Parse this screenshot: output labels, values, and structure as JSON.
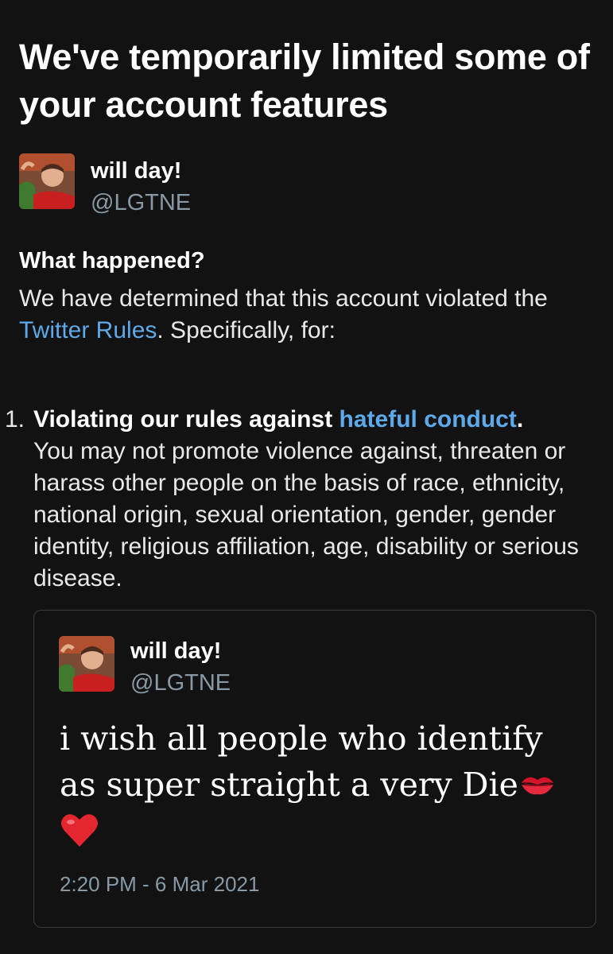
{
  "header": {
    "title": "We've temporarily limited some of your account features"
  },
  "account": {
    "display_name": "will day!",
    "handle": "@LGTNE"
  },
  "what_happened": {
    "heading": "What happened?",
    "body_before": "We have determined that this account violated the ",
    "link": "Twitter Rules",
    "body_after": ". Specifically, for:"
  },
  "rules": [
    {
      "number": "1.",
      "title_before": "Violating our rules against ",
      "title_link": "hateful conduct",
      "title_after": ".",
      "description": "You may not promote violence against, threaten or harass other people on the basis of race, ethnicity, national origin, sexual orientation, gender, gender identity, religious affiliation, age, disability or serious disease."
    }
  ],
  "tweet": {
    "display_name": "will day!",
    "handle": "@LGTNE",
    "text": "i wish all people who identify as super straight a very Die",
    "emoji_1": "kiss-mark-icon",
    "emoji_2": "red-heart-icon",
    "timestamp": "2:20 PM - 6 Mar 2021"
  },
  "colors": {
    "background": "#121212",
    "link": "#5ea9ea",
    "muted": "#8899a6",
    "card_border": "#3d3d3d"
  }
}
